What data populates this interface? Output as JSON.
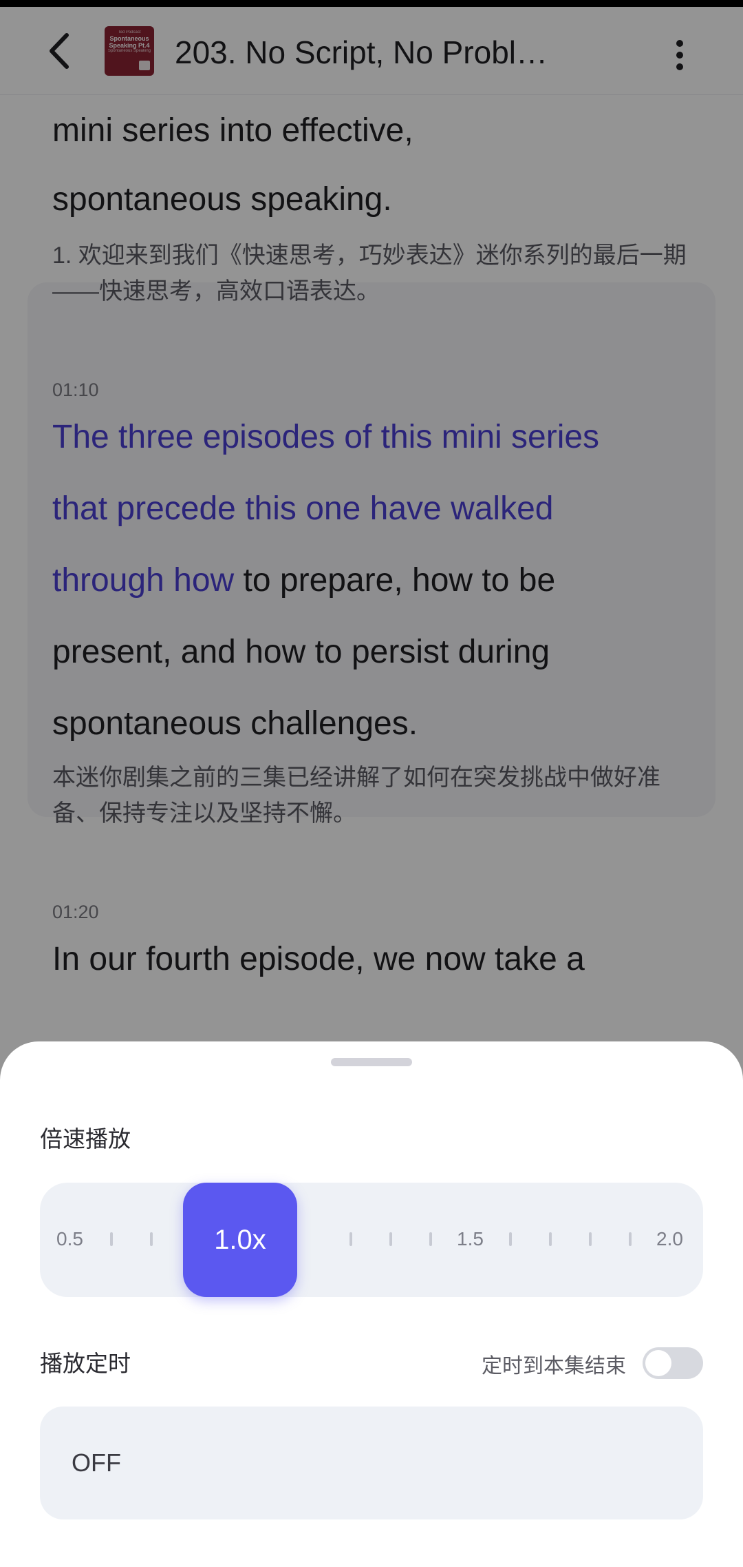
{
  "header": {
    "title": "203. No Script, No Probl…",
    "cover": {
      "top_text": "Ted Podcast",
      "line1": "Spontaneous",
      "line2": "Speaking Pt.4",
      "sub": "Spontaneous Speaking"
    }
  },
  "transcript": {
    "seg1_en_1": "mini series into effective,",
    "seg1_en_2": "spontaneous speaking.",
    "seg1_zh": "1. 欢迎来到我们《快速思考，巧妙表达》迷你系列的最后一期——快速思考，高效口语表达。",
    "seg2_time": "01:10",
    "seg2_en_l1": "The three episodes of this mini series",
    "seg2_en_l2": "that precede this one have walked",
    "seg2_en_l3_hl": "through how",
    "seg2_en_l3_rest": " to prepare, how to be",
    "seg2_en_l4": "present, and how to persist during",
    "seg2_en_l5": "spontaneous challenges.",
    "seg2_zh": "本迷你剧集之前的三集已经讲解了如何在突发挑战中做好准备、保持专注以及坚持不懈。",
    "seg3_time": "01:20",
    "seg3_en": "In our fourth episode, we now take a"
  },
  "sheet": {
    "speed_label": "倍速播放",
    "speed": {
      "min_label": "0.5",
      "mid_label": "1.5",
      "max_label": "2.0",
      "current_label": "1.0x",
      "current": 1.0
    },
    "timer_label": "播放定时",
    "end_of_episode_label": "定时到本集结束",
    "end_of_episode_on": false,
    "timer_value": "OFF"
  },
  "colors": {
    "accent": "#5b58f0",
    "highlight_text": "#4a3fd2",
    "track_bg": "#eef1f6"
  },
  "icons": [
    "back-arrow-icon",
    "more-vertical-icon"
  ]
}
